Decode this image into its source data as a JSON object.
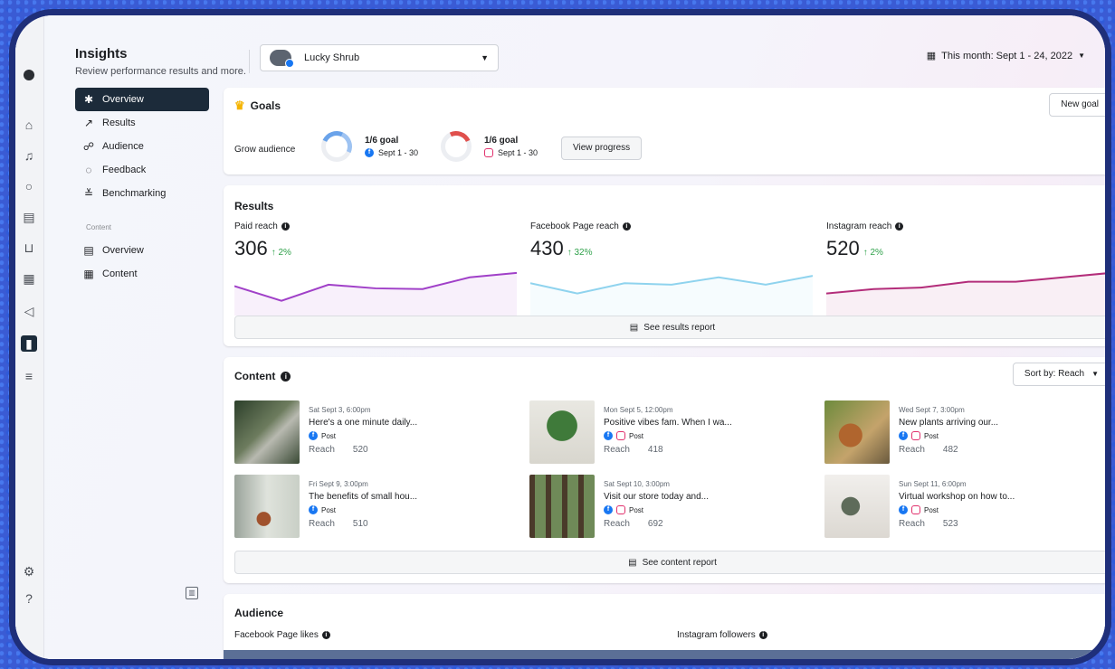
{
  "header": {
    "title": "Insights",
    "subtitle": "Review performance results and more.",
    "page_name": "Lucky Shrub",
    "date_range": "This month: Sept 1 - 24, 2022"
  },
  "nav": {
    "items": [
      {
        "label": "Overview",
        "icon": "overview-icon"
      },
      {
        "label": "Results",
        "icon": "results-icon"
      },
      {
        "label": "Audience",
        "icon": "audience-icon"
      },
      {
        "label": "Feedback",
        "icon": "feedback-icon"
      },
      {
        "label": "Benchmarking",
        "icon": "benchmarking-icon"
      }
    ],
    "content_section_label": "Content",
    "content_items": [
      {
        "label": "Overview",
        "icon": "content-overview-icon"
      },
      {
        "label": "Content",
        "icon": "content-table-icon"
      }
    ]
  },
  "goals": {
    "title": "Goals",
    "new_goal_label": "New goal",
    "grow_label": "Grow audience",
    "items": [
      {
        "goal": "1/6 goal",
        "period": "Sept 1 - 30",
        "platform": "facebook"
      },
      {
        "goal": "1/6 goal",
        "period": "Sept 1 - 30",
        "platform": "instagram"
      }
    ],
    "view_progress_label": "View progress"
  },
  "results": {
    "title": "Results",
    "metrics": [
      {
        "label": "Paid reach",
        "value": "306",
        "change": "↑ 2%",
        "color": "#a040c8",
        "trend": [
          40,
          20,
          42,
          37,
          36,
          52,
          58
        ]
      },
      {
        "label": "Facebook Page reach",
        "value": "430",
        "change": "↑ 32%",
        "color": "#8fd3ee",
        "trend": [
          44,
          30,
          44,
          42,
          52,
          42,
          54
        ]
      },
      {
        "label": "Instagram reach",
        "value": "520",
        "change": "↑ 2%",
        "color": "#b32d7a",
        "trend": [
          30,
          36,
          38,
          46,
          46,
          52,
          58
        ]
      }
    ],
    "report_label": "See results report"
  },
  "content": {
    "title": "Content",
    "sort_label": "Sort by: Reach",
    "posts": [
      {
        "date": "Sat Sept 3, 6:00pm",
        "text": "Here's a one minute daily...",
        "type": "Post",
        "reach_label": "Reach",
        "reach": "520",
        "instagram": false
      },
      {
        "date": "Mon Sept 5, 12:00pm",
        "text": "Positive vibes fam. When I wa...",
        "type": "Post",
        "reach_label": "Reach",
        "reach": "418",
        "instagram": true
      },
      {
        "date": "Wed Sept 7, 3:00pm",
        "text": "New plants arriving our...",
        "type": "Post",
        "reach_label": "Reach",
        "reach": "482",
        "instagram": true
      },
      {
        "date": "Fri Sept 9, 3:00pm",
        "text": "The benefits of small hou...",
        "type": "Post",
        "reach_label": "Reach",
        "reach": "510",
        "instagram": false
      },
      {
        "date": "Sat Sept 10, 3:00pm",
        "text": "Visit our store today and...",
        "type": "Post",
        "reach_label": "Reach",
        "reach": "692",
        "instagram": true
      },
      {
        "date": "Sun Sept 11, 6:00pm",
        "text": "Virtual workshop on how to...",
        "type": "Post",
        "reach_label": "Reach",
        "reach": "523",
        "instagram": true
      }
    ],
    "report_label": "See content report"
  },
  "audience": {
    "title": "Audience",
    "fb_label": "Facebook Page likes",
    "ig_label": "Instagram followers"
  }
}
